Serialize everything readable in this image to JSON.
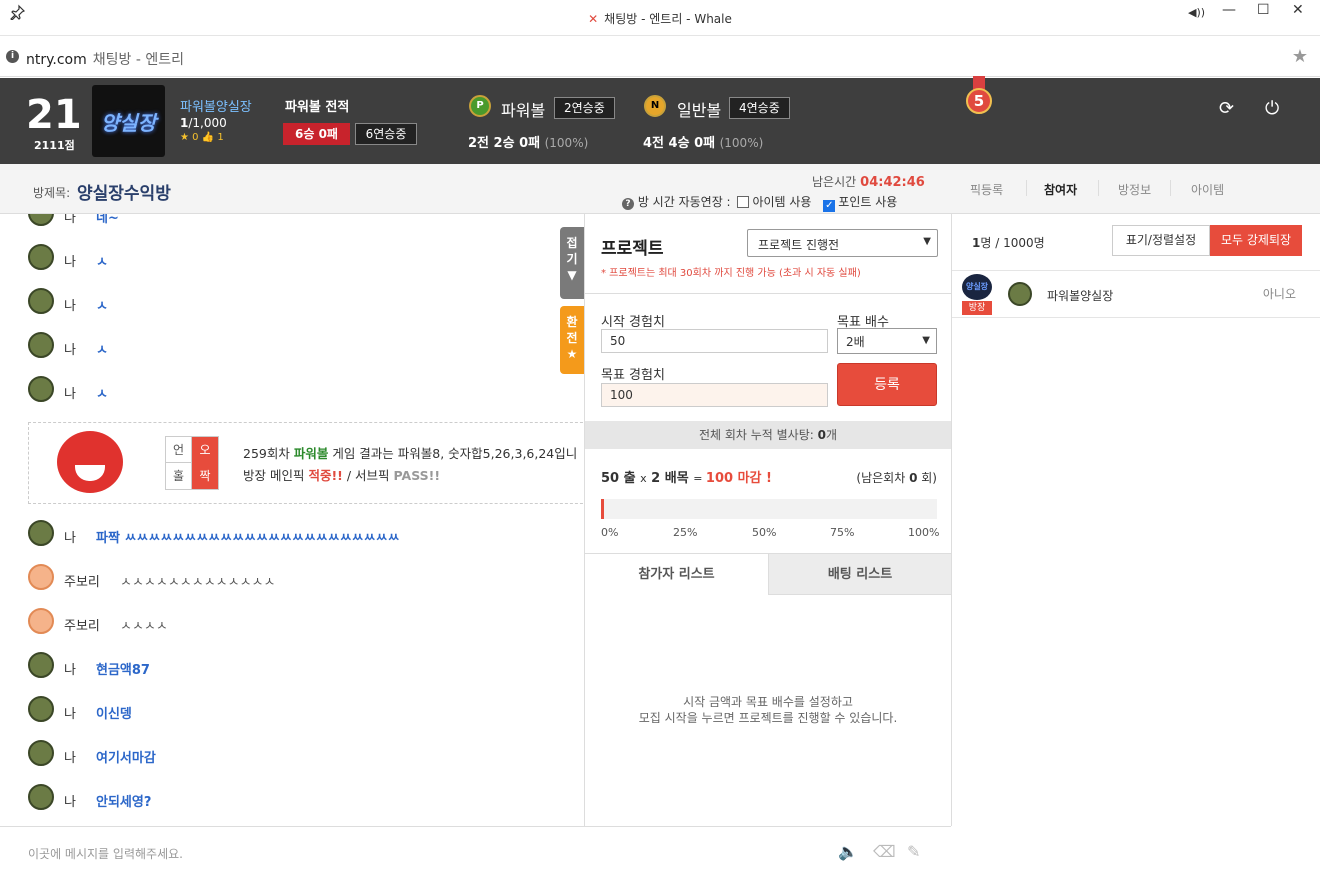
{
  "window": {
    "title": "채팅방 - 엔트리 - Whale"
  },
  "address": {
    "host": "ntry.com",
    "title": "채팅방 - 엔트리"
  },
  "header": {
    "level": "21",
    "points": "2111점",
    "avatar_text": "양실장",
    "user_name": "파워볼양실장",
    "rank_main": "1",
    "rank_total": "/1,000",
    "star_count": "0",
    "like_count": "1",
    "record_title": "파워볼 전적",
    "record_win": "6승 0패",
    "record_streak": "6연승중",
    "powerball": {
      "coin": "P",
      "name": "파워볼",
      "streak": "2연승중",
      "record": "2전 2승 0패",
      "pct": "(100%)"
    },
    "normalball": {
      "coin": "N",
      "name": "일반볼",
      "streak": "4연승중",
      "record": "4전 4승 0패",
      "pct": "(100%)"
    },
    "medal": "5"
  },
  "room": {
    "label": "방제목:",
    "name": "양실장수익방",
    "remain_label": "남은시간",
    "remain_time": "04:42:46",
    "auto_extend": "방 시간 자동연장 :",
    "opt_item": "아이템 사용",
    "opt_point": "포인트 사용",
    "tabs": [
      "픽등록",
      "참여자",
      "방정보",
      "아이템"
    ]
  },
  "chat": {
    "messages": [
      {
        "name": "나",
        "text": "네~"
      },
      {
        "name": "나",
        "text": "ㅅ"
      },
      {
        "name": "나",
        "text": "ㅅ"
      },
      {
        "name": "나",
        "text": "ㅅ"
      },
      {
        "name": "나",
        "text": "ㅅ"
      },
      {
        "name": "나",
        "text": "파짝 ㅆㅆㅆㅆㅆㅆㅆㅆㅆㅆㅆㅆㅆㅆㅆㅆㅆㅆㅆㅆㅆㅆㅆ"
      },
      {
        "name": "주보리",
        "text": "ㅅㅅㅅㅅㅅㅅㅅㅅㅅㅅㅅㅅㅅ"
      },
      {
        "name": "주보리",
        "text": "ㅅㅅㅅㅅ"
      },
      {
        "name": "나",
        "text": "현금액87"
      },
      {
        "name": "나",
        "text": "이신뎅"
      },
      {
        "name": "나",
        "text": "여기서마감"
      },
      {
        "name": "나",
        "text": "안되세영?"
      }
    ],
    "result": {
      "ox": [
        "언",
        "오",
        "홀",
        "짝"
      ],
      "line1_a": "259회차 ",
      "line1_b": "파워볼",
      "line1_c": " 게임 결과는 파워볼8, 숫자합5,26,3,6,24입니",
      "line2_a": "방장 메인픽 ",
      "line2_b": "적중!!",
      "line2_c": " / 서브픽 ",
      "line2_d": "PASS!!"
    },
    "fold_label": "접기",
    "swap_label": "환전",
    "input_placeholder": "이곳에 메시지를 입력해주세요."
  },
  "project": {
    "title": "프로젝트",
    "status_select": "프로젝트 진행전",
    "note": "* 프로젝트는 최대 30회차 까지 진행 가능 (초과 시 자동 실패)",
    "start_exp_label": "시작 경험치",
    "start_exp_value": "50",
    "target_mult_label": "목표 배수",
    "target_mult_value": "2배",
    "target_exp_label": "목표 경험치",
    "target_exp_value": "100",
    "register": "등록",
    "cum_a": "전체 회차 누적 별사탕: ",
    "cum_b": "0",
    "cum_c": "개",
    "calc_a": "50",
    "calc_b": " 출 ",
    "calc_x1": "x",
    "calc_c": " 2",
    "calc_d": " 배목 ",
    "calc_e": "= ",
    "calc_f": "100 마감 !",
    "remain_a": "(남은회차 ",
    "remain_b": "0",
    "remain_c": " 회)",
    "progress": 0.01,
    "ticks": [
      "0%",
      "25%",
      "50%",
      "75%",
      "100%"
    ],
    "tabs": [
      "참가자 리스트",
      "배팅 리스트"
    ],
    "empty_1": "시작 금액과 목표 배수를 설정하고",
    "empty_2": "모집 시작을 누르면 프로젝트를 진행할 수 있습니다."
  },
  "participants": {
    "count_a": "1",
    "count_b": "명 / 1000명",
    "sort_btn": "표기/정렬설정",
    "kick_btn": "모두 강제퇴장",
    "rows": [
      {
        "badge": "방장",
        "avatar_text": "양실장",
        "name": "파워볼양실장",
        "status": "아니오"
      }
    ]
  },
  "colors": {
    "accent": "#e74c3c",
    "header_bg": "#3e3e3e",
    "link": "#2c67c9"
  }
}
